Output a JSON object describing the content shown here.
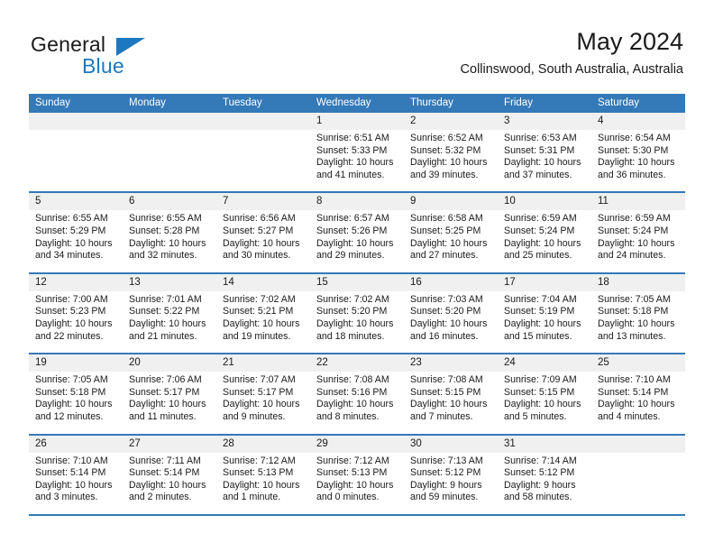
{
  "brand": {
    "word_one": "General",
    "word_two": "Blue",
    "logo_icon": "triangle-logo-icon"
  },
  "header": {
    "title": "May 2024",
    "location": "Collinswood, South Australia, Australia"
  },
  "calendar": {
    "weekday_headers": [
      "Sunday",
      "Monday",
      "Tuesday",
      "Wednesday",
      "Thursday",
      "Friday",
      "Saturday"
    ],
    "colors": {
      "header_blue": "#3479b8",
      "day_band_gray": "#f0f0f0",
      "brand_blue": "#1c78c0",
      "text": "#1a1a1a"
    },
    "weeks": [
      [
        {
          "day": "",
          "lines": []
        },
        {
          "day": "",
          "lines": []
        },
        {
          "day": "",
          "lines": []
        },
        {
          "day": "1",
          "lines": [
            "Sunrise: 6:51 AM",
            "Sunset: 5:33 PM",
            "Daylight: 10 hours",
            "and 41 minutes."
          ]
        },
        {
          "day": "2",
          "lines": [
            "Sunrise: 6:52 AM",
            "Sunset: 5:32 PM",
            "Daylight: 10 hours",
            "and 39 minutes."
          ]
        },
        {
          "day": "3",
          "lines": [
            "Sunrise: 6:53 AM",
            "Sunset: 5:31 PM",
            "Daylight: 10 hours",
            "and 37 minutes."
          ]
        },
        {
          "day": "4",
          "lines": [
            "Sunrise: 6:54 AM",
            "Sunset: 5:30 PM",
            "Daylight: 10 hours",
            "and 36 minutes."
          ]
        }
      ],
      [
        {
          "day": "5",
          "lines": [
            "Sunrise: 6:55 AM",
            "Sunset: 5:29 PM",
            "Daylight: 10 hours",
            "and 34 minutes."
          ]
        },
        {
          "day": "6",
          "lines": [
            "Sunrise: 6:55 AM",
            "Sunset: 5:28 PM",
            "Daylight: 10 hours",
            "and 32 minutes."
          ]
        },
        {
          "day": "7",
          "lines": [
            "Sunrise: 6:56 AM",
            "Sunset: 5:27 PM",
            "Daylight: 10 hours",
            "and 30 minutes."
          ]
        },
        {
          "day": "8",
          "lines": [
            "Sunrise: 6:57 AM",
            "Sunset: 5:26 PM",
            "Daylight: 10 hours",
            "and 29 minutes."
          ]
        },
        {
          "day": "9",
          "lines": [
            "Sunrise: 6:58 AM",
            "Sunset: 5:25 PM",
            "Daylight: 10 hours",
            "and 27 minutes."
          ]
        },
        {
          "day": "10",
          "lines": [
            "Sunrise: 6:59 AM",
            "Sunset: 5:24 PM",
            "Daylight: 10 hours",
            "and 25 minutes."
          ]
        },
        {
          "day": "11",
          "lines": [
            "Sunrise: 6:59 AM",
            "Sunset: 5:24 PM",
            "Daylight: 10 hours",
            "and 24 minutes."
          ]
        }
      ],
      [
        {
          "day": "12",
          "lines": [
            "Sunrise: 7:00 AM",
            "Sunset: 5:23 PM",
            "Daylight: 10 hours",
            "and 22 minutes."
          ]
        },
        {
          "day": "13",
          "lines": [
            "Sunrise: 7:01 AM",
            "Sunset: 5:22 PM",
            "Daylight: 10 hours",
            "and 21 minutes."
          ]
        },
        {
          "day": "14",
          "lines": [
            "Sunrise: 7:02 AM",
            "Sunset: 5:21 PM",
            "Daylight: 10 hours",
            "and 19 minutes."
          ]
        },
        {
          "day": "15",
          "lines": [
            "Sunrise: 7:02 AM",
            "Sunset: 5:20 PM",
            "Daylight: 10 hours",
            "and 18 minutes."
          ]
        },
        {
          "day": "16",
          "lines": [
            "Sunrise: 7:03 AM",
            "Sunset: 5:20 PM",
            "Daylight: 10 hours",
            "and 16 minutes."
          ]
        },
        {
          "day": "17",
          "lines": [
            "Sunrise: 7:04 AM",
            "Sunset: 5:19 PM",
            "Daylight: 10 hours",
            "and 15 minutes."
          ]
        },
        {
          "day": "18",
          "lines": [
            "Sunrise: 7:05 AM",
            "Sunset: 5:18 PM",
            "Daylight: 10 hours",
            "and 13 minutes."
          ]
        }
      ],
      [
        {
          "day": "19",
          "lines": [
            "Sunrise: 7:05 AM",
            "Sunset: 5:18 PM",
            "Daylight: 10 hours",
            "and 12 minutes."
          ]
        },
        {
          "day": "20",
          "lines": [
            "Sunrise: 7:06 AM",
            "Sunset: 5:17 PM",
            "Daylight: 10 hours",
            "and 11 minutes."
          ]
        },
        {
          "day": "21",
          "lines": [
            "Sunrise: 7:07 AM",
            "Sunset: 5:17 PM",
            "Daylight: 10 hours",
            "and 9 minutes."
          ]
        },
        {
          "day": "22",
          "lines": [
            "Sunrise: 7:08 AM",
            "Sunset: 5:16 PM",
            "Daylight: 10 hours",
            "and 8 minutes."
          ]
        },
        {
          "day": "23",
          "lines": [
            "Sunrise: 7:08 AM",
            "Sunset: 5:15 PM",
            "Daylight: 10 hours",
            "and 7 minutes."
          ]
        },
        {
          "day": "24",
          "lines": [
            "Sunrise: 7:09 AM",
            "Sunset: 5:15 PM",
            "Daylight: 10 hours",
            "and 5 minutes."
          ]
        },
        {
          "day": "25",
          "lines": [
            "Sunrise: 7:10 AM",
            "Sunset: 5:14 PM",
            "Daylight: 10 hours",
            "and 4 minutes."
          ]
        }
      ],
      [
        {
          "day": "26",
          "lines": [
            "Sunrise: 7:10 AM",
            "Sunset: 5:14 PM",
            "Daylight: 10 hours",
            "and 3 minutes."
          ]
        },
        {
          "day": "27",
          "lines": [
            "Sunrise: 7:11 AM",
            "Sunset: 5:14 PM",
            "Daylight: 10 hours",
            "and 2 minutes."
          ]
        },
        {
          "day": "28",
          "lines": [
            "Sunrise: 7:12 AM",
            "Sunset: 5:13 PM",
            "Daylight: 10 hours",
            "and 1 minute."
          ]
        },
        {
          "day": "29",
          "lines": [
            "Sunrise: 7:12 AM",
            "Sunset: 5:13 PM",
            "Daylight: 10 hours",
            "and 0 minutes."
          ]
        },
        {
          "day": "30",
          "lines": [
            "Sunrise: 7:13 AM",
            "Sunset: 5:12 PM",
            "Daylight: 9 hours",
            "and 59 minutes."
          ]
        },
        {
          "day": "31",
          "lines": [
            "Sunrise: 7:14 AM",
            "Sunset: 5:12 PM",
            "Daylight: 9 hours",
            "and 58 minutes."
          ]
        },
        {
          "day": "",
          "lines": []
        }
      ]
    ]
  }
}
